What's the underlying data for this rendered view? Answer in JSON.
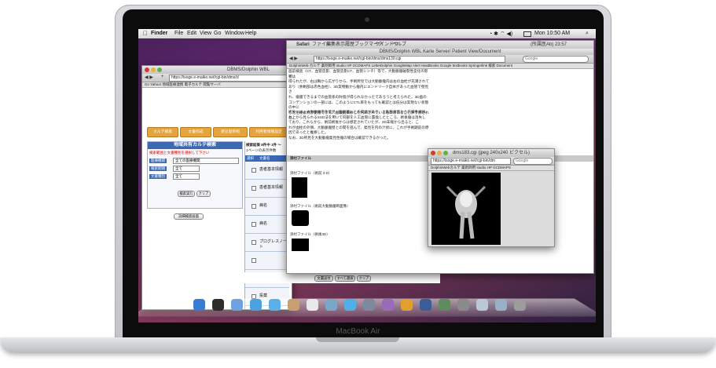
{
  "device": {
    "brand": "MacBook Air"
  },
  "menubar": {
    "apple": "",
    "app": "Finder",
    "items": [
      "File",
      "Edit",
      "View",
      "Go",
      "Window",
      "Help"
    ],
    "clock": "Mon 10:50 AM"
  },
  "colors": {
    "accent": "#3c69b3",
    "tab": "#e6a43c",
    "red": "#d33a2c",
    "amber": "#e8b040",
    "green": "#5fb449"
  },
  "windowA": {
    "title": "DBMS/Dolphin WBL",
    "url": "https://isoge.e-maiko.net/cgi-bin/dms/d",
    "bookmarks": "Go Yahoo! 地域医療連携 電子カルテ 閲覧サーバ",
    "tabs": [
      "カルテ検索",
      "文書作成",
      "受診歴参照",
      "利用者情報設定"
    ],
    "panel_title": "地域共有カルテ検索",
    "hint": "検索範囲と文書種別を選択して下さい",
    "fields": [
      {
        "label": "医療機関",
        "value": "全ての医療機関"
      },
      {
        "label": "検索期間",
        "value": "全て"
      },
      {
        "label": "文書種別",
        "value": "全て"
      }
    ],
    "buttons": [
      "検索実行",
      "クリア"
    ],
    "detail_button": "詳細検索画面",
    "list_header": "検索結果 8件中 1件 〜",
    "list_sub": "1ページの表示件数",
    "columns": [
      "選択",
      "文書名"
    ],
    "rows": [
      "患者基本情報",
      "患者基本情報",
      "病名",
      "病名",
      "プログレスノート",
      "",
      "投薬",
      "投薬"
    ],
    "bottom_buttons": [
      "文書送付",
      "すべて選択",
      "クリア"
    ]
  },
  "windowB": {
    "title": "DBMS/Dolphin WBL Karte Server/ Patient View/Document",
    "safari_menu": [
      "Safari",
      "ファイル",
      "編集",
      "表示",
      "履歴",
      "ブックマーク",
      "ウインドウ",
      "ヘルプ"
    ],
    "status": "(所属医Ab) 23:57",
    "url": "https://isoge.e-maiko.net/cgi-bin/dms/dms130.cgi",
    "search": "Google",
    "bookmarks": "DolphinWeb-カルテ 薬剤師用 studio HP GCDMAPS LetterDolphin GoogleMap Alert HeadBooks Google textbooks Springerlink 検索 Document",
    "paragraph1": "画前検査（CT、血管造影、血管造影CT、血管シンチ）等で、大動脈瘤破裂性変化の影響は\n得られたが、右は胸から広がりから、手術所見では大動脈瘤内は右の血栓が充満されて\nあり（余剰部は赤色血栓）、3D実物動から瘤内にエンドリーク自体があった血管で壁見さ\nれ、瘤膜できるまでの血管系の貯留が得られなかったであろうと考えられた。3D画の\nコンデンションの一部には、このようにCTL目をもっても確認とは低分は実現ない状態の中に\nした治療素材が使用できて、搬載指摘療した判断されているものがあることが予想され\nた。",
    "paragraph2": "術後には、大動脈瘤内を発見（動脈管）との交流があり、大動脈瘤内から内臓を摘除。\n右上から見られるSSD法を用いて同部を人工血管に置換したところ、術後瘤は消失し\nており、これらから、術前術後からは想定されていたが、3D末端から出ると、こ\nれが血栓の外側、大動脈瘤壁との間を進んで、発見を内の汁状に、これが手術期前の原\n因であったと推察した。\nなお、3D所見を大動脈瘤発見性瘤の場合は確認できるかった。",
    "attachments_title": "添付ファイル",
    "attachments": [
      "添付ファイル（術前 3 D）",
      "添付ファイル（術前大動脈瘤断面像）",
      "添付ファイル（術後3D）"
    ]
  },
  "windowC": {
    "title": "dms183.cgi (jpeg 240x240 ピクセル)",
    "url": "https://isoge.e-maiko.net/cgi-bin/dm",
    "search": "Google",
    "bookmarks": "DolphinWebカルテ 薬剤師用 studio HP GCDMAPS"
  },
  "dock": {
    "icons": [
      "finder-icon",
      "dashboard-icon",
      "mail-icon",
      "safari-icon",
      "ichat-icon",
      "addressbook-icon",
      "ical-icon",
      "preview-icon",
      "itunes-icon",
      "photo-icon",
      "imovie-icon",
      "garageband-icon",
      "spaces-icon",
      "timemachine-icon",
      "sysprefs-icon",
      "documents-icon",
      "downloads-icon",
      "trash-icon"
    ]
  }
}
